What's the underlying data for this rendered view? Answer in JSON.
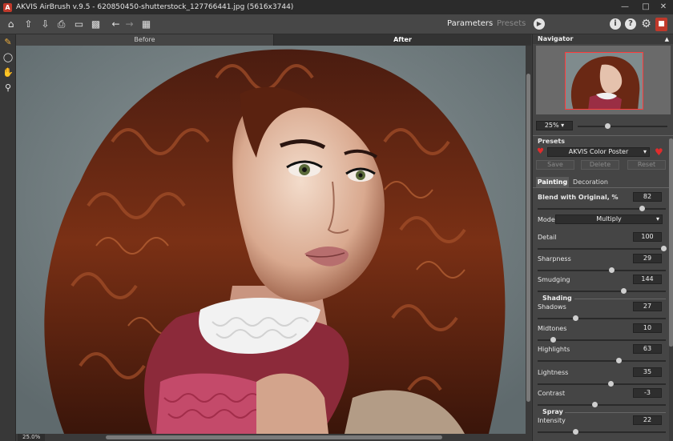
{
  "window": {
    "title": "AKVIS AirBrush v.9.5 - 620850450-shutterstock_127766441.jpg (5616x3744)",
    "app_logo_glyph": "A"
  },
  "toolbar": {
    "parameters_label": "Parameters",
    "presets_label": "Presets"
  },
  "canvas_tabs": {
    "before": "Before",
    "after": "After"
  },
  "status": {
    "zoom": "25.0%"
  },
  "navigator": {
    "title": "Navigator",
    "zoom": "25%",
    "zoom_slider_level": 0.25
  },
  "presets": {
    "title": "Presets",
    "selected": "AKVIS Color Poster",
    "save": "Save",
    "delete": "Delete",
    "reset": "Reset"
  },
  "tabs": {
    "painting": "Painting",
    "decoration": "Decoration"
  },
  "params": {
    "blend_label": "Blend with Original, %",
    "blend_value": "82",
    "mode_label": "Mode:",
    "mode_value": "Multiply",
    "detail_label": "Detail",
    "detail_value": "100",
    "sharpness_label": "Sharpness",
    "sharpness_value": "29",
    "smudging_label": "Smudging",
    "smudging_value": "144",
    "shading_title": "Shading",
    "shadows_label": "Shadows",
    "shadows_value": "27",
    "midtones_label": "Midtones",
    "midtones_value": "10",
    "highlights_label": "Highlights",
    "highlights_value": "63",
    "lightness_label": "Lightness",
    "lightness_value": "35",
    "contrast_label": "Contrast",
    "contrast_value": "-3",
    "spray_title": "Spray",
    "intensity_label": "Intensity",
    "intensity_value": "22"
  },
  "colors": {
    "accent_red": "#e02c2c",
    "panel_bg": "#454545"
  }
}
